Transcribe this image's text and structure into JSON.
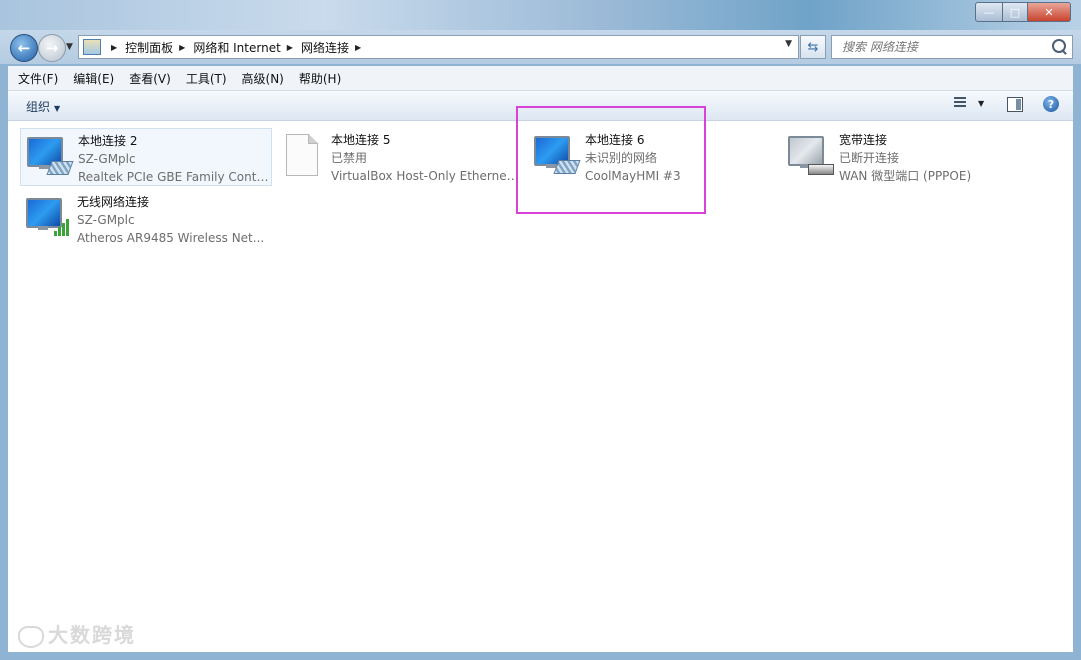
{
  "window": {
    "min_label": "—",
    "max_label": "□",
    "close_label": "✕"
  },
  "nav": {
    "back_label": "←",
    "forward_label": "→",
    "breadcrumbs": [
      "控制面板",
      "网络和 Internet",
      "网络连接"
    ],
    "search_placeholder": "搜索 网络连接"
  },
  "menu": [
    "文件(F)",
    "编辑(E)",
    "查看(V)",
    "工具(T)",
    "高级(N)",
    "帮助(H)"
  ],
  "toolbar": {
    "organize_label": "组织",
    "help_label": "?"
  },
  "connections": [
    {
      "name": "本地连接 2",
      "status": "SZ-GMplc",
      "device": "Realtek PCIe GBE Family Contr...",
      "icon": "wired-network-icon"
    },
    {
      "name": "本地连接 5",
      "status": "已禁用",
      "device": "VirtualBox Host-Only Ethernet ...",
      "icon": "disabled-network-icon"
    },
    {
      "name": "本地连接 6",
      "status": "未识别的网络",
      "device": "CoolMayHMI #3",
      "icon": "wired-network-icon"
    },
    {
      "name": "宽带连接",
      "status": "已断开连接",
      "device": "WAN 微型端口 (PPPOE)",
      "icon": "broadband-modem-icon"
    },
    {
      "name": "无线网络连接",
      "status": "SZ-GMplc",
      "device": "Atheros AR9485 Wireless Net...",
      "icon": "wireless-network-icon"
    }
  ],
  "colors": {
    "highlight": "#d842d8",
    "selection": "#cfe0f2"
  },
  "watermark": "大数跨境"
}
